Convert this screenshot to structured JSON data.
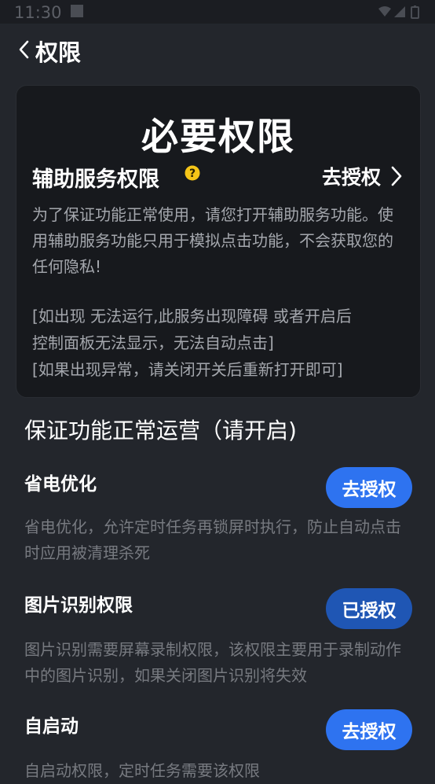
{
  "status_bar": {
    "time": "11:30"
  },
  "header": {
    "title": "权限"
  },
  "required_card": {
    "title": "必要权限",
    "service_name": "辅助服务权限",
    "auth_action": "去授权",
    "description": "为了保证功能正常使用，请您打开辅助服务功能。使用辅助服务功能只用于模拟点击功能，不会获取您的任何隐私!",
    "notes": [
      "[如出现 无法运行,此服务出现障碍 或者开启后",
      "控制面板无法显示，无法自动点击]",
      "[如果出现异常，请关闭开关后重新打开即可]"
    ]
  },
  "section": {
    "heading": "保证功能正常运营（请开启)"
  },
  "permissions": [
    {
      "name": "省电优化",
      "button": "去授权",
      "status": "pending",
      "description": "省电优化，允许定时任务再锁屏时执行，防止自动点击时应用被清理杀死"
    },
    {
      "name": "图片识别权限",
      "button": "已授权",
      "status": "granted",
      "description": "图片识别需要屏幕录制权限，该权限主要用于录制动作中的图片识别，如果关闭图片识别将失效"
    },
    {
      "name": "自启动",
      "button": "去授权",
      "status": "pending",
      "description": "自启动权限，定时任务需要该权限"
    }
  ],
  "colors": {
    "button_active": "#2e73f0",
    "button_granted": "#1f56b4",
    "background": "#23262c",
    "card": "#17191d",
    "help_icon": "#f5c518"
  }
}
